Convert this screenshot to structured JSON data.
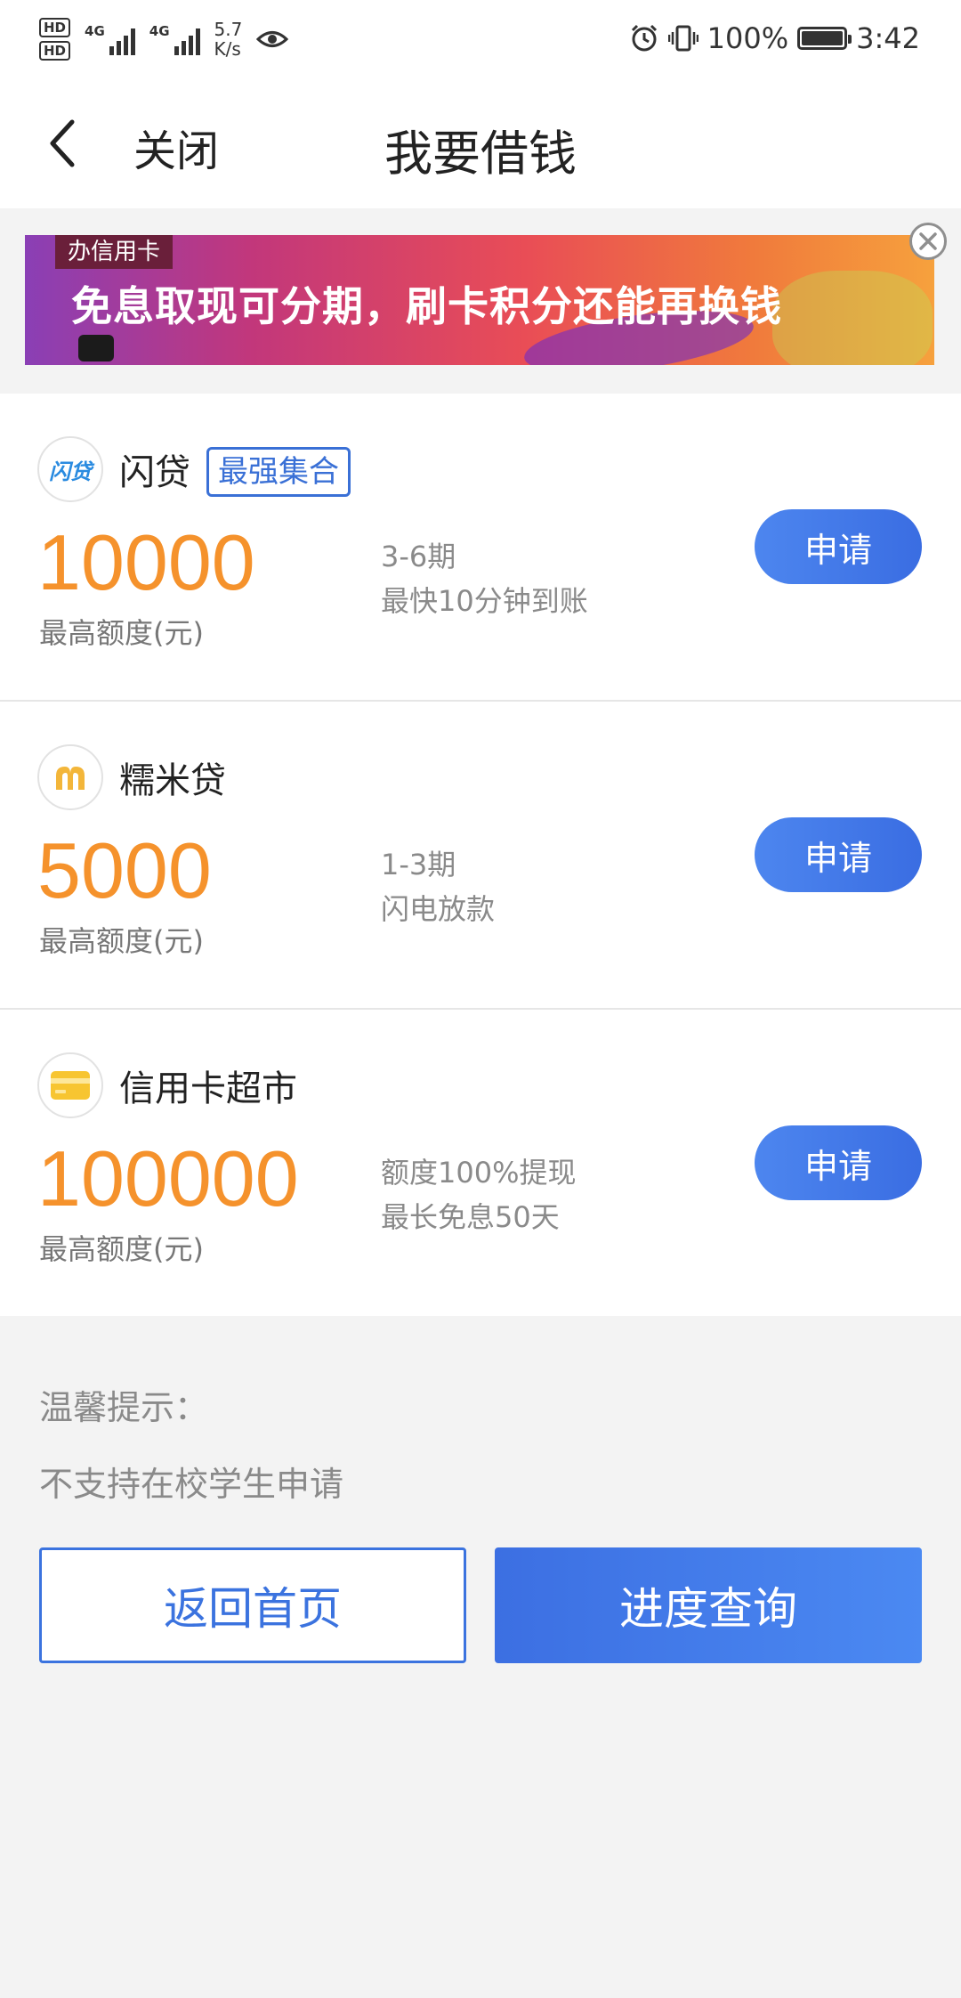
{
  "status_bar": {
    "hd1": "HD",
    "hd2": "HD",
    "net1": "4G",
    "net2": "4G",
    "speed_value": "5.7",
    "speed_unit": "K/s",
    "battery": "100%",
    "time": "3:42"
  },
  "nav": {
    "close_label": "关闭",
    "title": "我要借钱"
  },
  "banner": {
    "tag": "办信用卡",
    "text": "免息取现可分期，刷卡积分还能再换钱"
  },
  "products": [
    {
      "name": "闪贷",
      "logo_text": "闪贷",
      "tag": "最强集合",
      "amount": "10000",
      "amount_label": "最高额度(元)",
      "desc1": "3-6期",
      "desc2": "最快10分钟到账",
      "apply_label": "申请"
    },
    {
      "name": "糯米贷",
      "amount": "5000",
      "amount_label": "最高额度(元)",
      "desc1": "1-3期",
      "desc2": "闪电放款",
      "apply_label": "申请"
    },
    {
      "name": "信用卡超市",
      "amount": "100000",
      "amount_label": "最高额度(元)",
      "desc1": "额度100%提现",
      "desc2": "最长免息50天",
      "apply_label": "申请"
    }
  ],
  "tips": {
    "title": "温馨提示：",
    "text": "不支持在校学生申请"
  },
  "buttons": {
    "home": "返回首页",
    "progress": "进度查询"
  },
  "colors": {
    "accent_blue": "#3b73df",
    "amount_orange": "#f5922c"
  }
}
